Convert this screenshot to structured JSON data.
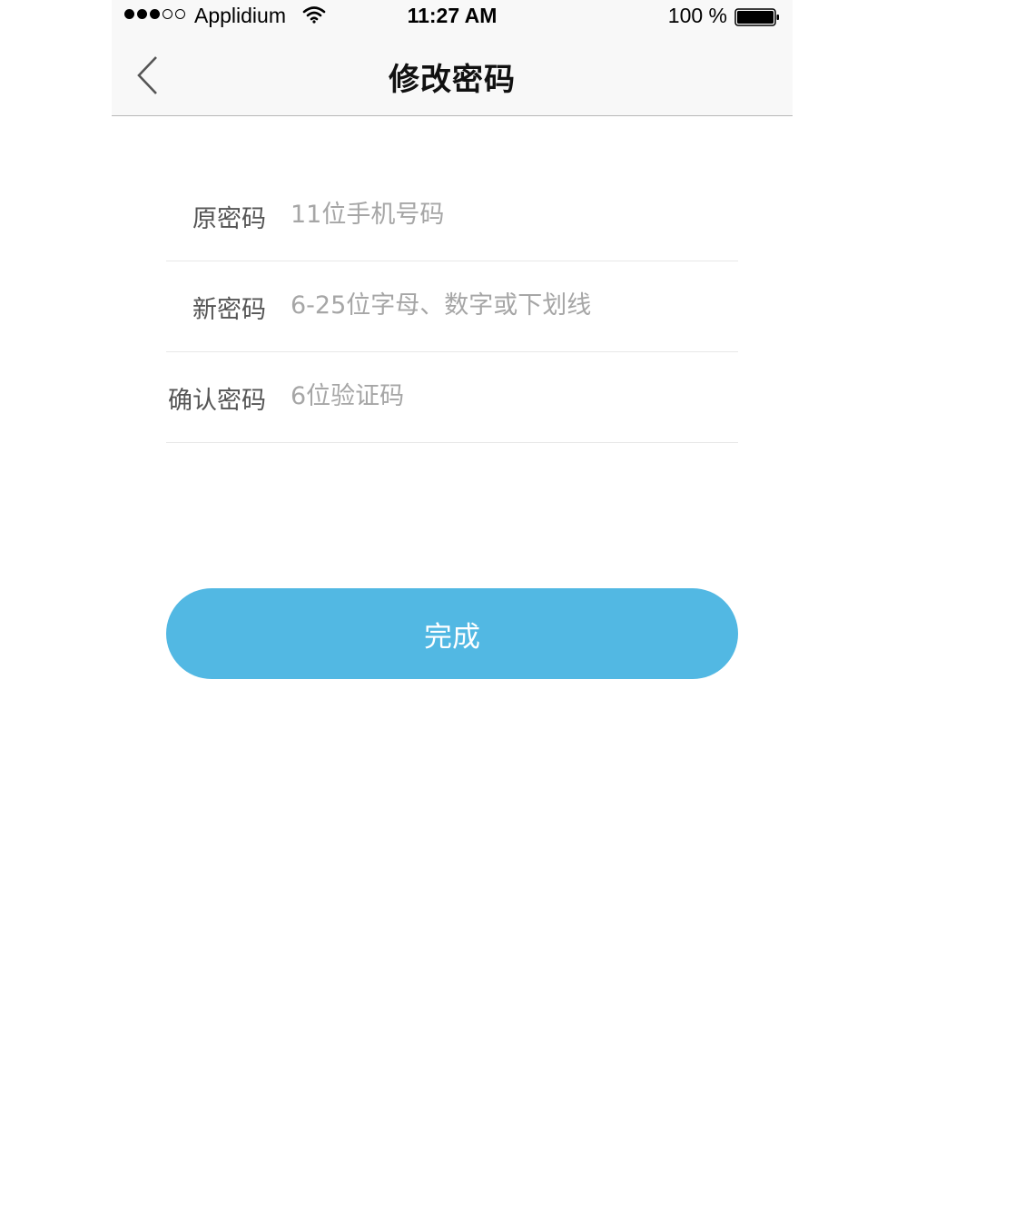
{
  "status_bar": {
    "carrier": "Applidium",
    "time": "11:27 AM",
    "battery": "100 %",
    "signal_icon": "signal-dots-icon",
    "wifi_icon": "wifi-icon",
    "battery_icon": "battery-icon"
  },
  "nav": {
    "back_icon": "chevron-left-icon",
    "title": "修改密码"
  },
  "form": {
    "fields": [
      {
        "label": "原密码",
        "placeholder": "11位手机号码",
        "value": ""
      },
      {
        "label": "新密码",
        "placeholder": "6-25位字母、数字或下划线",
        "value": ""
      },
      {
        "label": "确认密码",
        "placeholder": "6位验证码",
        "value": ""
      }
    ]
  },
  "submit": {
    "label": "完成"
  },
  "colors": {
    "accent": "#52b8e3",
    "bar_background": "#f8f8f8",
    "label_text": "#555555",
    "placeholder_text": "#a6a6a6",
    "divider": "#e8e8e8"
  }
}
